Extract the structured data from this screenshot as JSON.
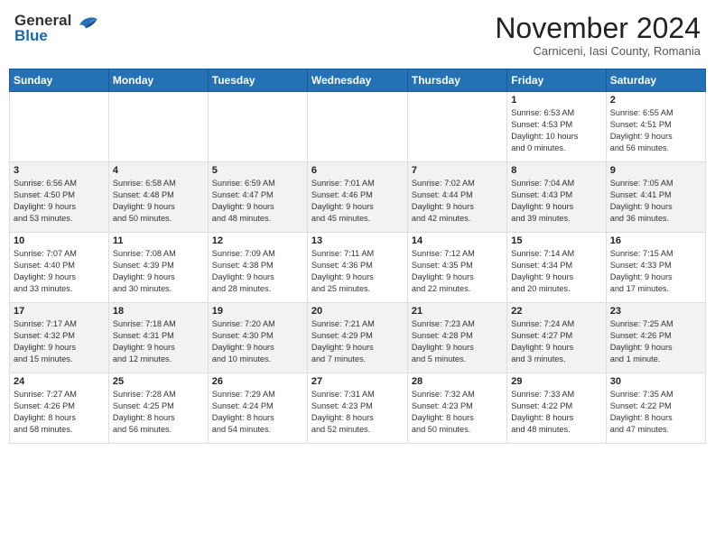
{
  "header": {
    "logo_general": "General",
    "logo_blue": "Blue",
    "month_title": "November 2024",
    "subtitle": "Carniceni, Iasi County, Romania"
  },
  "days_of_week": [
    "Sunday",
    "Monday",
    "Tuesday",
    "Wednesday",
    "Thursday",
    "Friday",
    "Saturday"
  ],
  "weeks": [
    [
      {
        "day": "",
        "content": ""
      },
      {
        "day": "",
        "content": ""
      },
      {
        "day": "",
        "content": ""
      },
      {
        "day": "",
        "content": ""
      },
      {
        "day": "",
        "content": ""
      },
      {
        "day": "1",
        "content": "Sunrise: 6:53 AM\nSunset: 4:53 PM\nDaylight: 10 hours\nand 0 minutes."
      },
      {
        "day": "2",
        "content": "Sunrise: 6:55 AM\nSunset: 4:51 PM\nDaylight: 9 hours\nand 56 minutes."
      }
    ],
    [
      {
        "day": "3",
        "content": "Sunrise: 6:56 AM\nSunset: 4:50 PM\nDaylight: 9 hours\nand 53 minutes."
      },
      {
        "day": "4",
        "content": "Sunrise: 6:58 AM\nSunset: 4:48 PM\nDaylight: 9 hours\nand 50 minutes."
      },
      {
        "day": "5",
        "content": "Sunrise: 6:59 AM\nSunset: 4:47 PM\nDaylight: 9 hours\nand 48 minutes."
      },
      {
        "day": "6",
        "content": "Sunrise: 7:01 AM\nSunset: 4:46 PM\nDaylight: 9 hours\nand 45 minutes."
      },
      {
        "day": "7",
        "content": "Sunrise: 7:02 AM\nSunset: 4:44 PM\nDaylight: 9 hours\nand 42 minutes."
      },
      {
        "day": "8",
        "content": "Sunrise: 7:04 AM\nSunset: 4:43 PM\nDaylight: 9 hours\nand 39 minutes."
      },
      {
        "day": "9",
        "content": "Sunrise: 7:05 AM\nSunset: 4:41 PM\nDaylight: 9 hours\nand 36 minutes."
      }
    ],
    [
      {
        "day": "10",
        "content": "Sunrise: 7:07 AM\nSunset: 4:40 PM\nDaylight: 9 hours\nand 33 minutes."
      },
      {
        "day": "11",
        "content": "Sunrise: 7:08 AM\nSunset: 4:39 PM\nDaylight: 9 hours\nand 30 minutes."
      },
      {
        "day": "12",
        "content": "Sunrise: 7:09 AM\nSunset: 4:38 PM\nDaylight: 9 hours\nand 28 minutes."
      },
      {
        "day": "13",
        "content": "Sunrise: 7:11 AM\nSunset: 4:36 PM\nDaylight: 9 hours\nand 25 minutes."
      },
      {
        "day": "14",
        "content": "Sunrise: 7:12 AM\nSunset: 4:35 PM\nDaylight: 9 hours\nand 22 minutes."
      },
      {
        "day": "15",
        "content": "Sunrise: 7:14 AM\nSunset: 4:34 PM\nDaylight: 9 hours\nand 20 minutes."
      },
      {
        "day": "16",
        "content": "Sunrise: 7:15 AM\nSunset: 4:33 PM\nDaylight: 9 hours\nand 17 minutes."
      }
    ],
    [
      {
        "day": "17",
        "content": "Sunrise: 7:17 AM\nSunset: 4:32 PM\nDaylight: 9 hours\nand 15 minutes."
      },
      {
        "day": "18",
        "content": "Sunrise: 7:18 AM\nSunset: 4:31 PM\nDaylight: 9 hours\nand 12 minutes."
      },
      {
        "day": "19",
        "content": "Sunrise: 7:20 AM\nSunset: 4:30 PM\nDaylight: 9 hours\nand 10 minutes."
      },
      {
        "day": "20",
        "content": "Sunrise: 7:21 AM\nSunset: 4:29 PM\nDaylight: 9 hours\nand 7 minutes."
      },
      {
        "day": "21",
        "content": "Sunrise: 7:23 AM\nSunset: 4:28 PM\nDaylight: 9 hours\nand 5 minutes."
      },
      {
        "day": "22",
        "content": "Sunrise: 7:24 AM\nSunset: 4:27 PM\nDaylight: 9 hours\nand 3 minutes."
      },
      {
        "day": "23",
        "content": "Sunrise: 7:25 AM\nSunset: 4:26 PM\nDaylight: 9 hours\nand 1 minute."
      }
    ],
    [
      {
        "day": "24",
        "content": "Sunrise: 7:27 AM\nSunset: 4:26 PM\nDaylight: 8 hours\nand 58 minutes."
      },
      {
        "day": "25",
        "content": "Sunrise: 7:28 AM\nSunset: 4:25 PM\nDaylight: 8 hours\nand 56 minutes."
      },
      {
        "day": "26",
        "content": "Sunrise: 7:29 AM\nSunset: 4:24 PM\nDaylight: 8 hours\nand 54 minutes."
      },
      {
        "day": "27",
        "content": "Sunrise: 7:31 AM\nSunset: 4:23 PM\nDaylight: 8 hours\nand 52 minutes."
      },
      {
        "day": "28",
        "content": "Sunrise: 7:32 AM\nSunset: 4:23 PM\nDaylight: 8 hours\nand 50 minutes."
      },
      {
        "day": "29",
        "content": "Sunrise: 7:33 AM\nSunset: 4:22 PM\nDaylight: 8 hours\nand 48 minutes."
      },
      {
        "day": "30",
        "content": "Sunrise: 7:35 AM\nSunset: 4:22 PM\nDaylight: 8 hours\nand 47 minutes."
      }
    ]
  ]
}
